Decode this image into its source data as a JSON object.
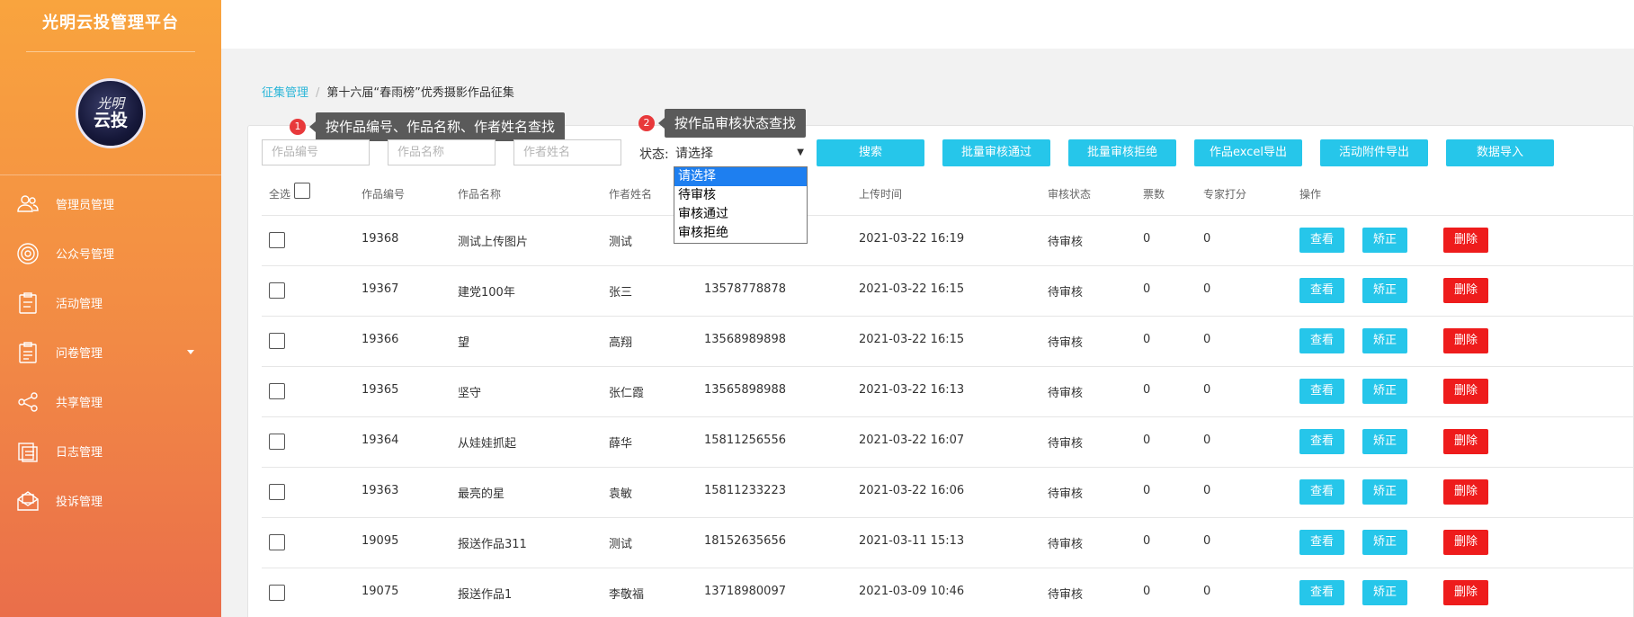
{
  "sidebar": {
    "brand": "光明云投管理平台",
    "logo_top": "光明",
    "logo_bottom": "云投",
    "items": [
      {
        "label": "管理员管理",
        "icon": "users-icon"
      },
      {
        "label": "公众号管理",
        "icon": "target-icon"
      },
      {
        "label": "活动管理",
        "icon": "clipboard-icon"
      },
      {
        "label": "问卷管理",
        "icon": "survey-icon",
        "has_submenu": true
      },
      {
        "label": "共享管理",
        "icon": "share-icon"
      },
      {
        "label": "日志管理",
        "icon": "log-icon"
      },
      {
        "label": "投诉管理",
        "icon": "mail-icon"
      }
    ]
  },
  "breadcrumb": {
    "parent": "征集管理",
    "separator": "/",
    "current": "第十六届“春雨榜”优秀摄影作品征集"
  },
  "tips": {
    "tip1": {
      "num": "1",
      "text": "按作品编号、作品名称、作者姓名查找"
    },
    "tip2": {
      "num": "2",
      "text": "按作品审核状态查找"
    }
  },
  "filters": {
    "work_id_placeholder": "作品编号",
    "work_name_placeholder": "作品名称",
    "author_placeholder": "作者姓名",
    "status_label": "状态:",
    "status_selected": "请选择",
    "status_options": [
      "请选择",
      "待审核",
      "审核通过",
      "审核拒绝"
    ]
  },
  "toolbar": {
    "search": "搜索",
    "batch_approve": "批量审核通过",
    "batch_reject": "批量审核拒绝",
    "export_excel": "作品excel导出",
    "export_attachments": "活动附件导出",
    "import_data": "数据导入"
  },
  "table": {
    "headers": {
      "select_all": "全选",
      "id": "作品编号",
      "name": "作品名称",
      "author": "作者姓名",
      "upload_time": "上传时间",
      "status": "审核状态",
      "votes": "票数",
      "expert_score": "专家打分",
      "actions": "操作"
    },
    "action_labels": {
      "view": "查看",
      "fix": "矫正",
      "delete": "删除"
    },
    "rows": [
      {
        "id": "19368",
        "name": "测试上传图片",
        "author": "测试",
        "phone": "",
        "time": "2021-03-22 16:19",
        "status": "待审核",
        "votes": "0",
        "score": "0"
      },
      {
        "id": "19367",
        "name": "建党100年",
        "author": "张三",
        "phone": "13578778878",
        "time": "2021-03-22 16:15",
        "status": "待审核",
        "votes": "0",
        "score": "0"
      },
      {
        "id": "19366",
        "name": "望",
        "author": "高翔",
        "phone": "13568989898",
        "time": "2021-03-22 16:15",
        "status": "待审核",
        "votes": "0",
        "score": "0"
      },
      {
        "id": "19365",
        "name": "坚守",
        "author": "张仁霞",
        "phone": "13565898988",
        "time": "2021-03-22 16:13",
        "status": "待审核",
        "votes": "0",
        "score": "0"
      },
      {
        "id": "19364",
        "name": "从娃娃抓起",
        "author": "薛华",
        "phone": "15811256556",
        "time": "2021-03-22 16:07",
        "status": "待审核",
        "votes": "0",
        "score": "0"
      },
      {
        "id": "19363",
        "name": "最亮的星",
        "author": "袁敏",
        "phone": "15811233223",
        "time": "2021-03-22 16:06",
        "status": "待审核",
        "votes": "0",
        "score": "0"
      },
      {
        "id": "19095",
        "name": "报送作品311",
        "author": "测试",
        "phone": "18152635656",
        "time": "2021-03-11 15:13",
        "status": "待审核",
        "votes": "0",
        "score": "0"
      },
      {
        "id": "19075",
        "name": "报送作品1",
        "author": "李敬福",
        "phone": "13718980097",
        "time": "2021-03-09 10:46",
        "status": "待审核",
        "votes": "0",
        "score": "0"
      }
    ]
  }
}
